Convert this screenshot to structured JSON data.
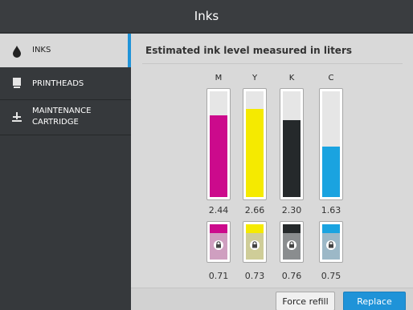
{
  "header": {
    "title": "Inks"
  },
  "sidebar": {
    "items": [
      {
        "label": "INKS",
        "icon": "ink-drop-icon",
        "active": true
      },
      {
        "label": "PRINTHEADS",
        "icon": "printhead-icon",
        "active": false
      },
      {
        "label": "MAINTENANCE\nCARTRIDGE",
        "icon": "maintenance-cartridge-icon",
        "active": false
      }
    ]
  },
  "main": {
    "title": "Estimated ink level measured in liters",
    "inks": [
      {
        "label": "M",
        "color": "#cc0a8c",
        "level_liters": "2.44",
        "level_fraction": 0.77,
        "cartridge_liters": "0.71",
        "cartridge_tint": "#cf9fc0"
      },
      {
        "label": "Y",
        "color": "#f5ea00",
        "level_liters": "2.66",
        "level_fraction": 0.83,
        "cartridge_liters": "0.73",
        "cartridge_tint": "#cfcd98"
      },
      {
        "label": "K",
        "color": "#25292b",
        "level_liters": "2.30",
        "level_fraction": 0.73,
        "cartridge_liters": "0.76",
        "cartridge_tint": "#8a8d8f"
      },
      {
        "label": "C",
        "color": "#1aa3e0",
        "level_liters": "1.63",
        "level_fraction": 0.48,
        "cartridge_liters": "0.75",
        "cartridge_tint": "#9cb8c7"
      }
    ]
  },
  "footer": {
    "force_refill_label": "Force refill",
    "replace_label": "Replace"
  },
  "colors": {
    "accent": "#1f93d8"
  }
}
